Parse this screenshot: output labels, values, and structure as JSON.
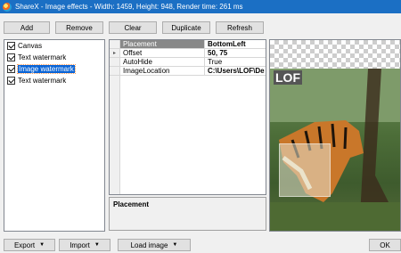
{
  "window": {
    "title": "ShareX - Image effects - Width: 1459, Height: 948, Render time: 261 ms"
  },
  "toolbar": {
    "add": "Add",
    "remove": "Remove",
    "clear": "Clear",
    "duplicate": "Duplicate",
    "refresh": "Refresh"
  },
  "effects": [
    {
      "label": "Canvas",
      "checked": true
    },
    {
      "label": "Text watermark",
      "checked": true
    },
    {
      "label": "Image watermark",
      "checked": true,
      "selected": true
    },
    {
      "label": "Text watermark",
      "checked": true
    }
  ],
  "properties": [
    {
      "name": "Placement",
      "value": "BottomLeft"
    },
    {
      "name": "Offset",
      "value": "50, 75"
    },
    {
      "name": "AutoHide",
      "value": "True"
    },
    {
      "name": "ImageLocation",
      "value": "C:\\Users\\LOF\\De"
    }
  ],
  "description": {
    "title": "Placement"
  },
  "preview": {
    "watermark_text": "LOF"
  },
  "bottom": {
    "export": "Export",
    "import": "Import",
    "load_image": "Load image",
    "ok": "OK"
  },
  "colors": {
    "titlebar": "#1b6fc4",
    "selection": "#0a64d6"
  }
}
